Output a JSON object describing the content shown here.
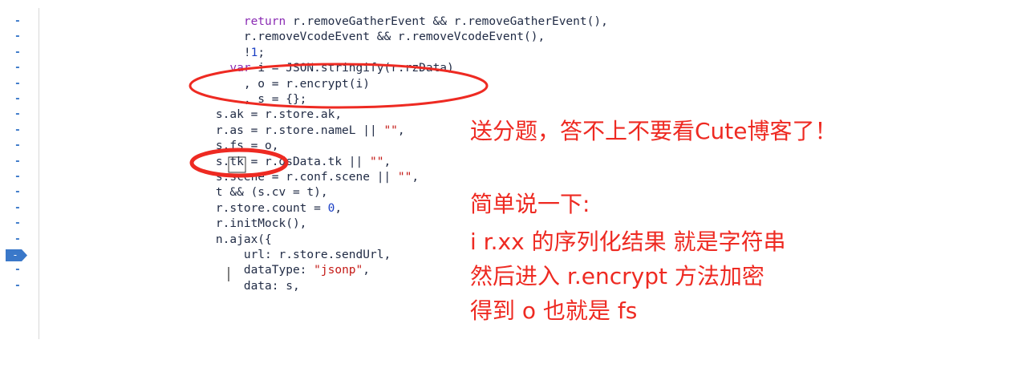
{
  "code_lines": [
    {
      "indent": "        ",
      "parts": [
        {
          "t": "return",
          "c": "kw"
        },
        {
          "t": " r.removeGatherEvent && r.removeGatherEvent(),"
        }
      ]
    },
    {
      "indent": "        ",
      "parts": [
        {
          "t": "r.removeVcodeEvent && r.removeVcodeEvent(),"
        }
      ]
    },
    {
      "indent": "        ",
      "parts": [
        {
          "t": "!"
        },
        {
          "t": "1",
          "c": "num"
        },
        {
          "t": ";"
        }
      ]
    },
    {
      "indent": "      ",
      "parts": [
        {
          "t": "var",
          "c": "kw"
        },
        {
          "t": " i = JSON.stringify(r.rzData)"
        }
      ]
    },
    {
      "indent": "        ",
      "parts": [
        {
          "t": ", o = r.encrypt(i)"
        }
      ]
    },
    {
      "indent": "        ",
      "parts": [
        {
          "t": ", s = {};"
        }
      ]
    },
    {
      "indent": "    ",
      "parts": [
        {
          "t": "s.ak = r.store.ak,"
        }
      ]
    },
    {
      "indent": "    ",
      "parts": [
        {
          "t": "r.as = r.store.nameL || "
        },
        {
          "t": "\"\"",
          "c": "str"
        },
        {
          "t": ","
        }
      ]
    },
    {
      "indent": "    ",
      "parts": [
        {
          "t": "s.fs = o,"
        }
      ]
    },
    {
      "indent": "    ",
      "parts": [
        {
          "t": "s.tk = r.dsData.tk || "
        },
        {
          "t": "\"\"",
          "c": "str"
        },
        {
          "t": ","
        }
      ]
    },
    {
      "indent": "    ",
      "parts": [
        {
          "t": "s.scene = r.conf.scene || "
        },
        {
          "t": "\"\"",
          "c": "str"
        },
        {
          "t": ","
        }
      ]
    },
    {
      "indent": "    ",
      "parts": [
        {
          "t": "t && (s.cv = t),"
        }
      ]
    },
    {
      "indent": "    ",
      "parts": [
        {
          "t": "r.store.count = "
        },
        {
          "t": "0",
          "c": "num"
        },
        {
          "t": ","
        }
      ]
    },
    {
      "indent": "    ",
      "parts": [
        {
          "t": "r.initMock(),"
        }
      ]
    },
    {
      "indent": "    ",
      "parts": [
        {
          "t": "n.ajax({"
        }
      ]
    },
    {
      "indent": "        ",
      "parts": [
        {
          "t": "url: r.store.sendUrl,"
        }
      ]
    },
    {
      "indent": "        ",
      "parts": [
        {
          "t": "dataType: "
        },
        {
          "t": "\"jsonp\"",
          "c": "str"
        },
        {
          "t": ","
        }
      ]
    },
    {
      "indent": "        ",
      "parts": [
        {
          "t": "data: s,"
        }
      ]
    }
  ],
  "gutter_marker": "-",
  "breakpoint_line": 15,
  "annotations": {
    "headline": "送分题，答不上不要看Cute博客了！",
    "line1": "简单说一下:",
    "line2": "i r.xx 的序列化结果 就是字符串",
    "line3": "然后进入 r.encrypt 方法加密",
    "line4": "得到 o 也就是 fs"
  },
  "colors": {
    "annotation_red": "#ee2a22",
    "keyword": "#8a2bb3",
    "number": "#1a3fc4",
    "string": "#c41a16",
    "breakpoint": "#3a78c9"
  }
}
